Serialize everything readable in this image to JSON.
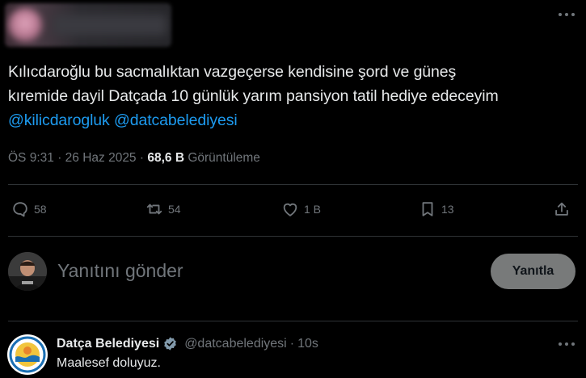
{
  "tweet": {
    "lines": [
      "Kılıcdaroğlu bu sacmalıktan  vazgeçerse  kendisine şord ve güneş",
      "kıremide dayil Datçada  10 günlük yarım pansiyon tatil hediye edeceyim"
    ],
    "mentions": [
      "@kilicdarogluk",
      "@datcabelediyesi"
    ],
    "time": "ÖS 9:31",
    "date": "26 Haz 2025",
    "views_count": "68,6 B",
    "views_label": "Görüntüleme"
  },
  "actions": {
    "replies": "58",
    "reposts": "54",
    "likes": "1 B",
    "bookmarks": "13"
  },
  "composer": {
    "placeholder": "Yanıtını gönder",
    "button": "Yanıtla"
  },
  "reply": {
    "name": "Datça Belediyesi",
    "handle": "@datcabelediyesi",
    "separator": "·",
    "time": "10s",
    "text": "Maalesef doluyuz."
  },
  "colors": {
    "accent": "#1d9bf0",
    "muted": "#71767b",
    "verified": "#829aab"
  }
}
